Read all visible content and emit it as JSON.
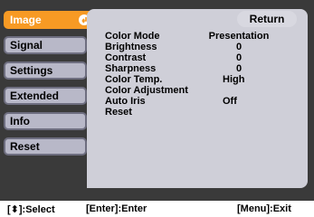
{
  "tabs": [
    {
      "label": "Image",
      "active": true
    },
    {
      "label": "Signal"
    },
    {
      "label": "Settings"
    },
    {
      "label": "Extended"
    },
    {
      "label": "Info"
    },
    {
      "label": "Reset"
    }
  ],
  "return_label": "Return",
  "items": [
    {
      "label": "Color Mode",
      "value": "Presentation"
    },
    {
      "label": "Brightness",
      "value": "0"
    },
    {
      "label": "Contrast",
      "value": "0"
    },
    {
      "label": "Sharpness",
      "value": "0"
    },
    {
      "label": "Color Temp.",
      "value": "High"
    },
    {
      "label": "Color Adjustment",
      "value": ""
    },
    {
      "label": "Auto Iris",
      "value": "Off"
    },
    {
      "label": "Reset",
      "value": ""
    }
  ],
  "footer": {
    "select": "[⬍]:Select",
    "enter": "[Enter]:Enter",
    "exit": "[Menu]:Exit"
  },
  "colors": {
    "active_tab": "#f79a24",
    "panel": "#cfcfd8",
    "background": "#3a3a3a"
  }
}
